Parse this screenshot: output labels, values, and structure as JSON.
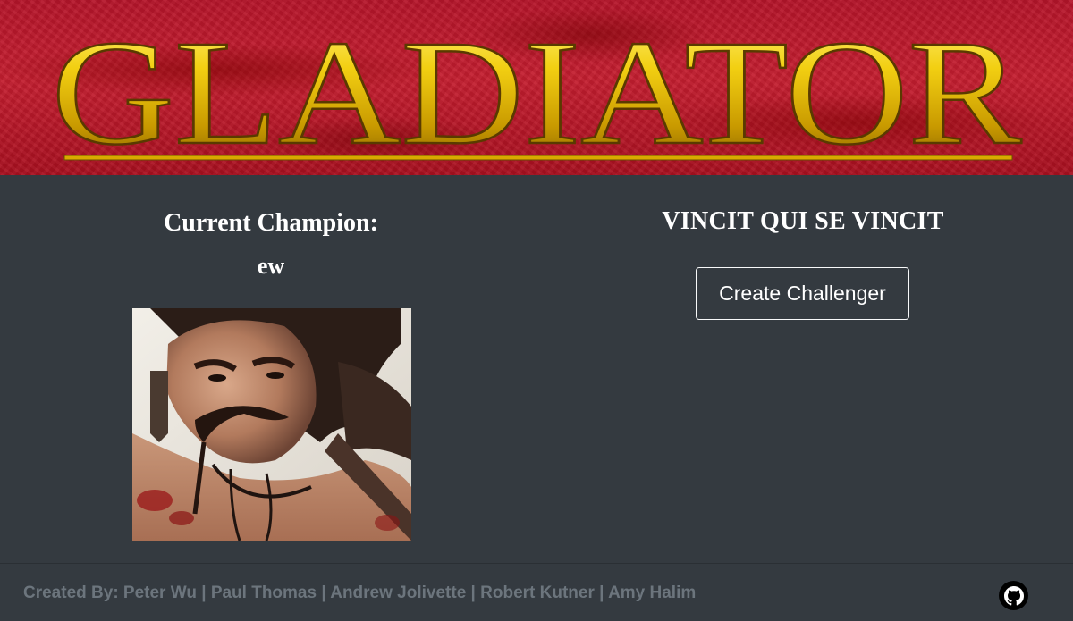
{
  "header": {
    "title": "GLADIATOR",
    "colors": {
      "banner_red": "#c41e30",
      "gold": "#e8c20a"
    }
  },
  "champion": {
    "label": "Current Champion:",
    "name": "ew",
    "portrait_icon": "gladiator-portrait"
  },
  "motto": "VINCIT QUI SE VINCIT",
  "actions": {
    "create_challenger_label": "Create Challenger"
  },
  "footer": {
    "created_by_label": "Created By: ",
    "authors": [
      "Peter Wu",
      "Paul Thomas",
      "Andrew Jolivette",
      "Robert Kutner",
      "Amy Halim"
    ],
    "separator": " | ",
    "github_icon": "github-icon"
  }
}
